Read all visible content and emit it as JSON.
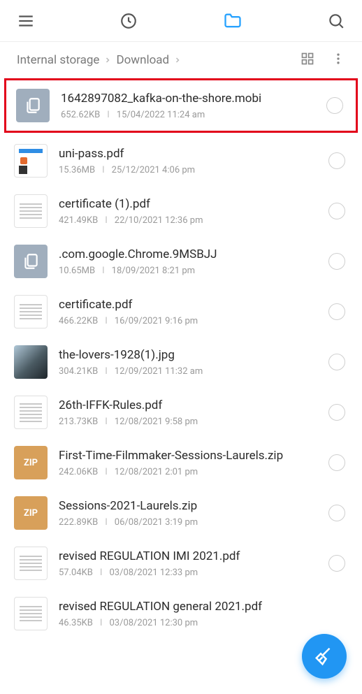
{
  "breadcrumb": {
    "root": "Internal storage",
    "current": "Download"
  },
  "files": [
    {
      "name": "1642897082_kafka-on-the-shore.mobi",
      "size": "652.62KB",
      "date": "15/04/2022 11:24 am"
    },
    {
      "name": "uni-pass.pdf",
      "size": "15.36MB",
      "date": "25/12/2021 4:06 pm"
    },
    {
      "name": "certificate (1).pdf",
      "size": "421.49KB",
      "date": "22/10/2021 12:36 pm"
    },
    {
      "name": ".com.google.Chrome.9MSBJJ",
      "size": "10.65MB",
      "date": "18/09/2021 8:21 pm"
    },
    {
      "name": "certificate.pdf",
      "size": "466.22KB",
      "date": "16/09/2021 9:16 pm"
    },
    {
      "name": "the-lovers-1928(1).jpg",
      "size": "304.21KB",
      "date": "12/09/2021 11:32 am"
    },
    {
      "name": "26th-IFFK-Rules.pdf",
      "size": "213.73KB",
      "date": "12/08/2021 9:58 pm"
    },
    {
      "name": "First-Time-Filmmaker-Sessions-Laurels.zip",
      "size": "242.06KB",
      "date": "12/08/2021 2:01 pm"
    },
    {
      "name": "Sessions-2021-Laurels.zip",
      "size": "222.89KB",
      "date": "06/08/2021 3:19 pm"
    },
    {
      "name": "revised REGULATION IMI 2021.pdf",
      "size": "57.04KB",
      "date": "03/08/2021 12:33 pm"
    },
    {
      "name": "revised REGULATION general 2021.pdf",
      "size": "46.35KB",
      "date": "03/08/2021 12:30 pm"
    }
  ],
  "zip_label": "ZIP"
}
